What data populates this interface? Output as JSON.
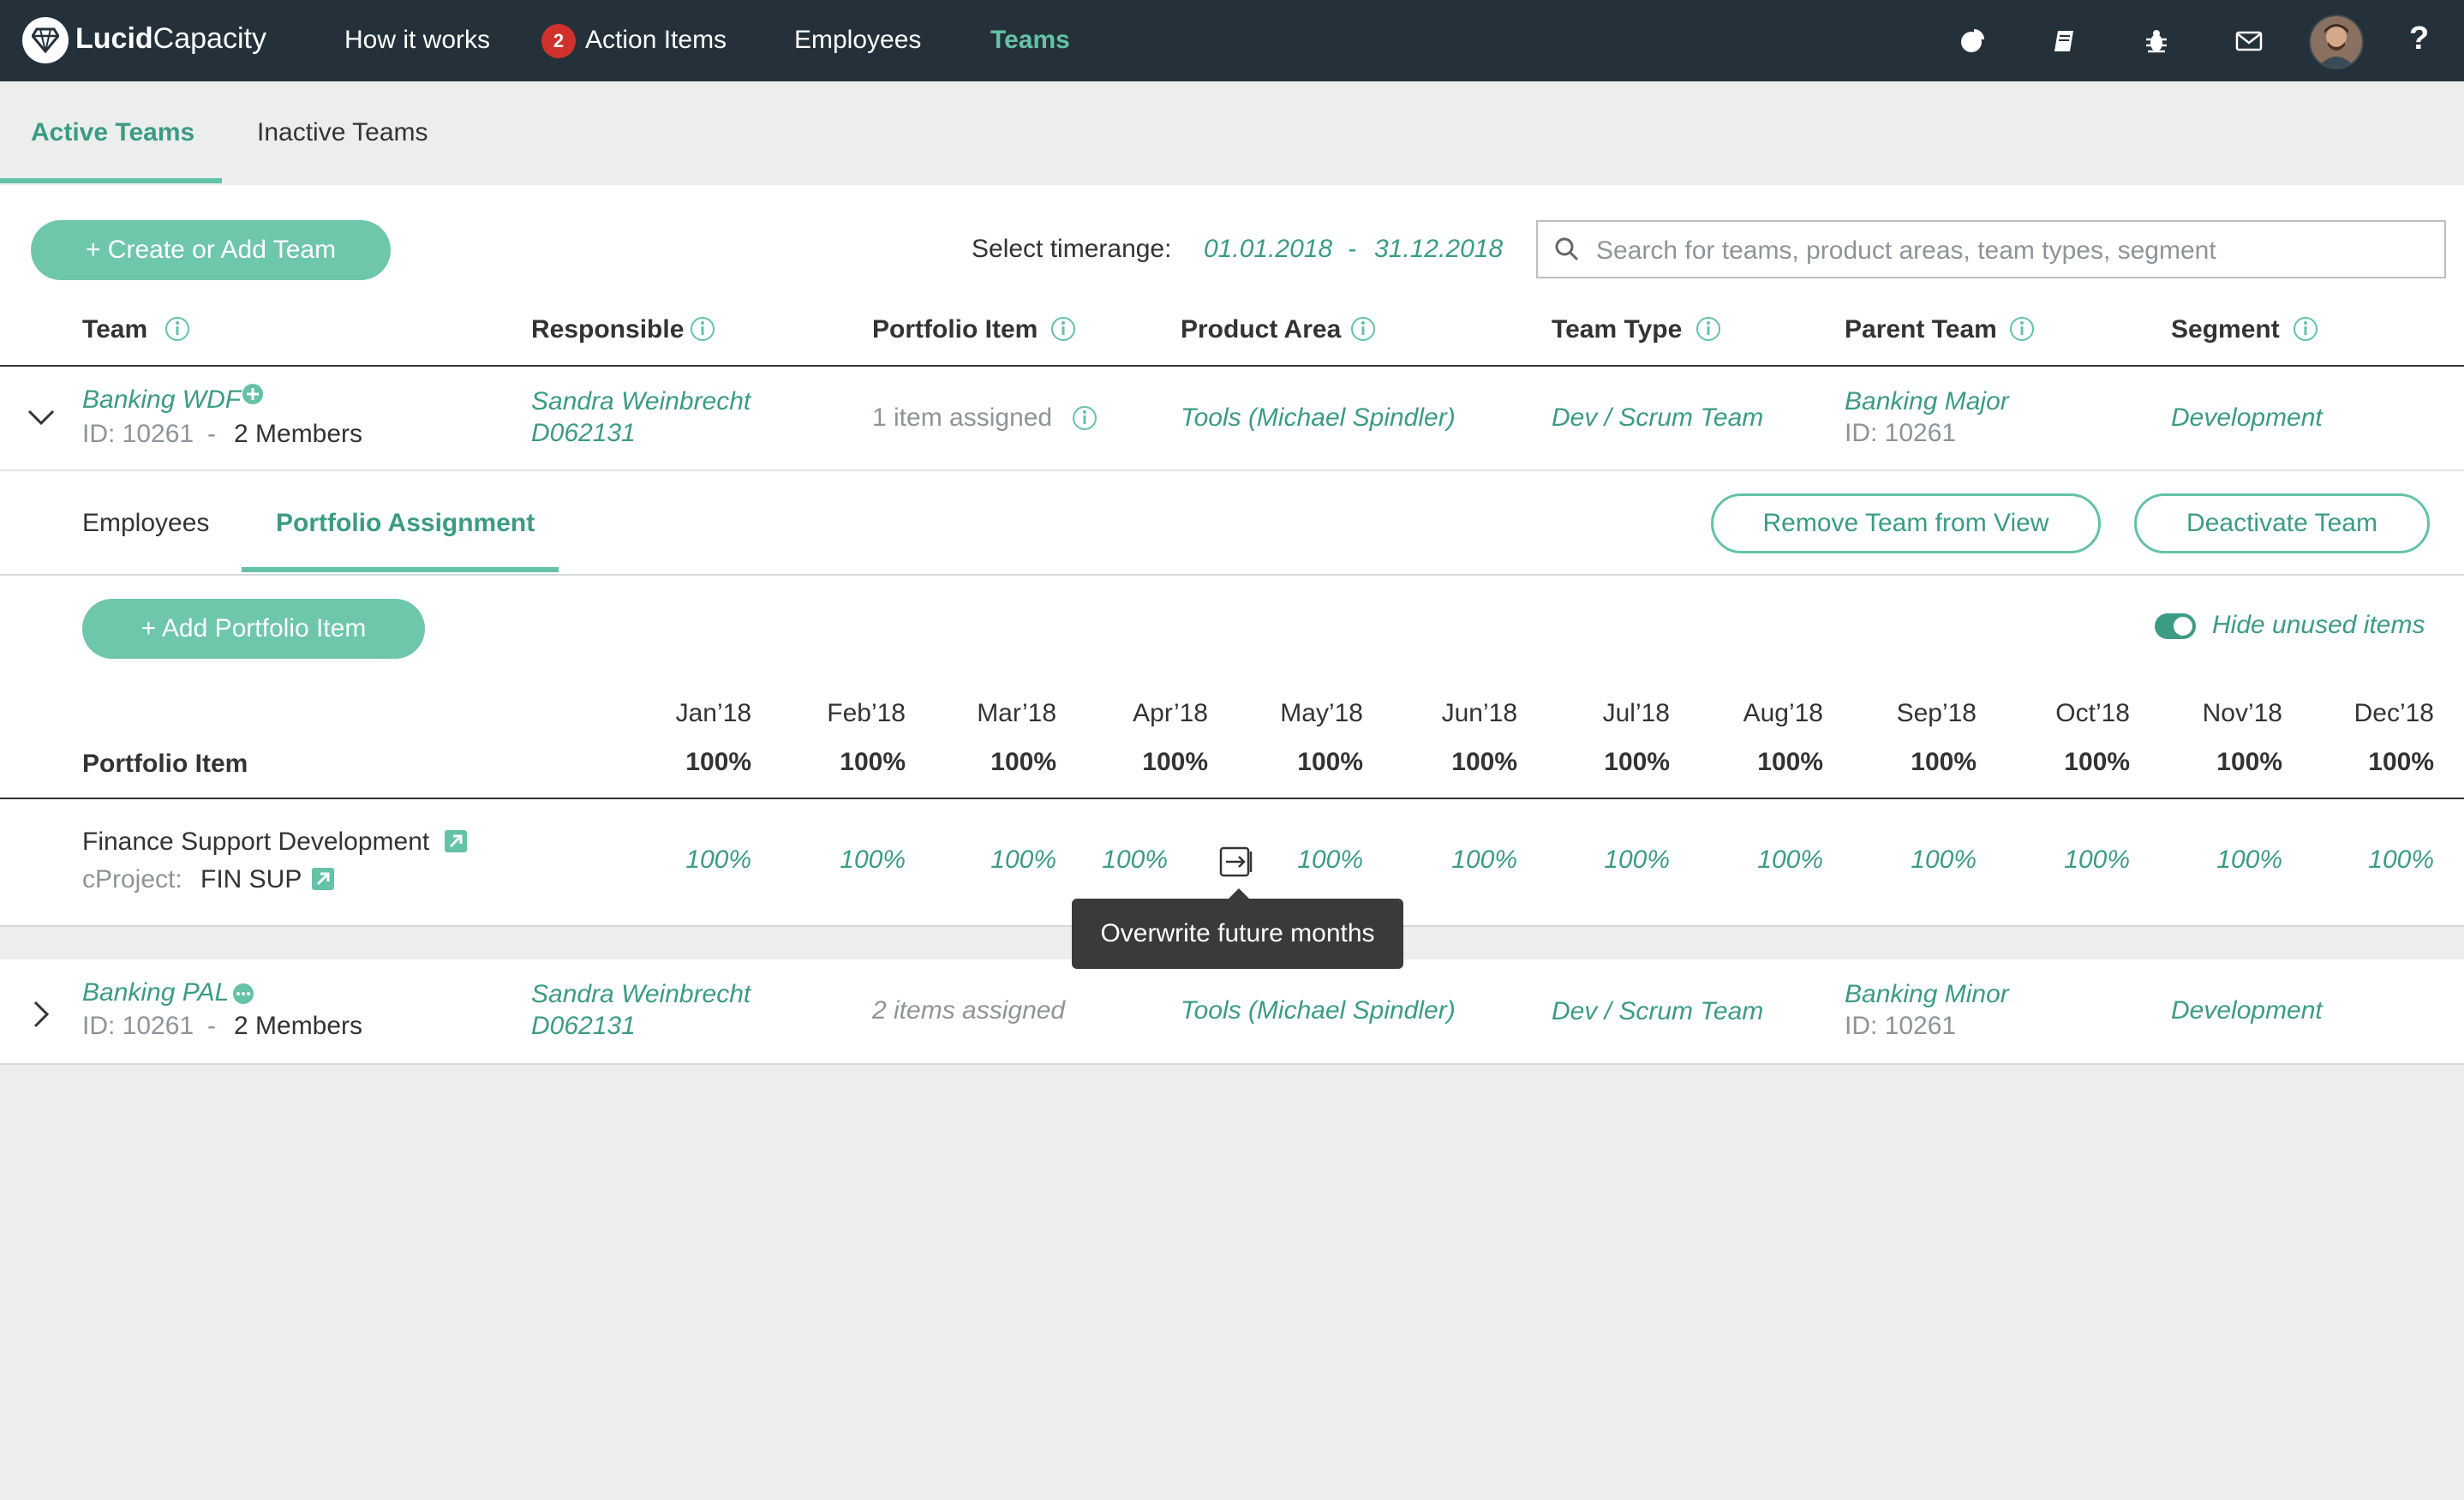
{
  "app": {
    "brand_bold": "Lucid",
    "brand_rest": "Capacity"
  },
  "nav": {
    "how_it_works": "How it works",
    "action_items_count": "2",
    "action_items": "Action Items",
    "employees": "Employees",
    "teams": "Teams",
    "icons": [
      "pie-chart-icon",
      "book-icon",
      "bug-icon",
      "mail-icon",
      "avatar",
      "help-icon"
    ],
    "help": "?"
  },
  "tabs": {
    "active": "Active Teams",
    "inactive": "Inactive Teams"
  },
  "toolbar": {
    "create_button": "+ Create or Add Team",
    "timerange_label": "Select timerange:",
    "date_from": "01.01.2018",
    "date_sep": "-",
    "date_to": "31.12.2018",
    "search_placeholder": "Search for teams, product areas, team types, segment"
  },
  "columns": {
    "team": "Team",
    "responsible": "Responsible",
    "portfolio_item": "Portfolio Item",
    "product_area": "Product Area",
    "team_type": "Team Type",
    "parent_team": "Parent Team",
    "segment": "Segment"
  },
  "teams": [
    {
      "name": "Banking WDF",
      "id": "ID: 10261",
      "sep": "-",
      "members": "2 Members",
      "responsible_name": "Sandra Weinbrecht",
      "responsible_id": "D062131",
      "portfolio": "1 item assigned",
      "product_area": "Tools (Michael Spindler)",
      "team_type": "Dev / Scrum Team",
      "parent_name": "Banking Major",
      "parent_id": "ID: 10261",
      "segment": "Development"
    },
    {
      "name": "Banking PAL",
      "id": "ID: 10261",
      "sep": "-",
      "members": "2 Members",
      "responsible_name": "Sandra Weinbrecht",
      "responsible_id": "D062131",
      "portfolio": "2 items assigned",
      "product_area": "Tools (Michael Spindler)",
      "team_type": "Dev / Scrum Team",
      "parent_name": "Banking Minor",
      "parent_id": "ID: 10261",
      "segment": "Development"
    }
  ],
  "detail": {
    "tab_employees": "Employees",
    "tab_portfolio": "Portfolio Assignment",
    "remove_button": "Remove Team from View",
    "deactivate_button": "Deactivate Team",
    "add_button": "+ Add Portfolio Item",
    "hide_unused": "Hide unused items",
    "portfolio_header": "Portfolio Item",
    "months": [
      "Jan’18",
      "Feb’18",
      "Mar’18",
      "Apr’18",
      "May’18",
      "Jun’18",
      "Jul’18",
      "Aug’18",
      "Sep’18",
      "Oct’18",
      "Nov’18",
      "Dec’18"
    ],
    "totals": [
      "100%",
      "100%",
      "100%",
      "100%",
      "100%",
      "100%",
      "100%",
      "100%",
      "100%",
      "100%",
      "100%",
      "100%"
    ],
    "item_name": "Finance Support Development",
    "item_project_label": "cProject:",
    "item_project_value": "FIN SUP",
    "item_values": [
      "100%",
      "100%",
      "100%",
      "100%",
      "100%",
      "100%",
      "100%",
      "100%",
      "100%",
      "100%",
      "100%",
      "100%"
    ],
    "tooltip": "Overwrite future months"
  },
  "colors": {
    "nav_bg": "#24313a",
    "accent": "#64c2a6",
    "accent_dark": "#3b9b84",
    "badge": "#d0312d"
  }
}
